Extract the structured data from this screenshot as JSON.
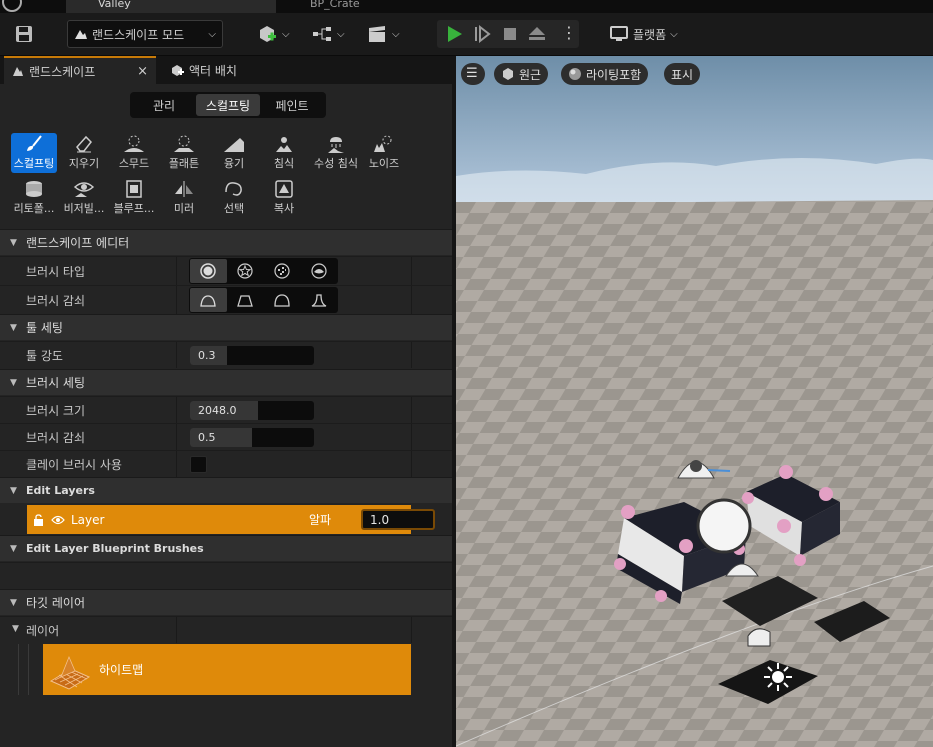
{
  "titlebar": {
    "tab1": "Valley",
    "tab2": "BP_Crate"
  },
  "toolbar": {
    "mode_label": "랜드스케이프 모드",
    "platform_label": "플랫폼"
  },
  "panel_tabs": {
    "landscape": "랜드스케이프",
    "place_actors": "액터 배치",
    "close_glyph": "×"
  },
  "mode_switch": {
    "manage": "관리",
    "sculpt": "스컬프팅",
    "paint": "페인트"
  },
  "tools": [
    {
      "label": "스컬프팅",
      "icon": "sculpt-brush-icon"
    },
    {
      "label": "지우기",
      "icon": "eraser-icon"
    },
    {
      "label": "스무드",
      "icon": "smooth-icon"
    },
    {
      "label": "플래튼",
      "icon": "flatten-icon"
    },
    {
      "label": "융기",
      "icon": "ramp-icon"
    },
    {
      "label": "침식",
      "icon": "erosion-icon"
    },
    {
      "label": "수성 침식",
      "icon": "hydro-erosion-icon"
    },
    {
      "label": "노이즈",
      "icon": "noise-icon"
    },
    {
      "label": "리토폴...",
      "icon": "retopologize-icon"
    },
    {
      "label": "비저빌...",
      "icon": "visibility-icon"
    },
    {
      "label": "블루프...",
      "icon": "blueprint-icon"
    },
    {
      "label": "미러",
      "icon": "mirror-icon"
    },
    {
      "label": "선택",
      "icon": "select-icon"
    },
    {
      "label": "복사",
      "icon": "copy-icon"
    }
  ],
  "sections": {
    "landscape_editor": "랜드스케이프 에디터",
    "tool_settings": "툴 세팅",
    "brush_settings": "브러시 세팅",
    "edit_layers": "Edit Layers",
    "edit_layer_bp": "Edit Layer Blueprint Brushes",
    "target_layers": "타깃 레이어"
  },
  "props": {
    "brush_type": "브러시 타입",
    "brush_falloff": "브러시 감쇠",
    "tool_strength": "툴 강도",
    "tool_strength_value": "0.3",
    "brush_size": "브러시 크기",
    "brush_size_value": "2048.0",
    "brush_falloff2": "브러시 감쇠",
    "brush_falloff2_value": "0.5",
    "clay_brush": "클레이 브러시 사용"
  },
  "layer": {
    "name": "Layer",
    "alpha_label": "알파",
    "alpha_value": "1.0"
  },
  "target": {
    "layers_label": "레이어",
    "heightmap": "하이트맵"
  },
  "viewport": {
    "perspective": "원근",
    "lit": "라이팅포함",
    "show": "표시"
  },
  "values": {
    "tool_strength": 0.3,
    "brush_size_fill": 0.55,
    "brush_falloff": 0.5
  }
}
